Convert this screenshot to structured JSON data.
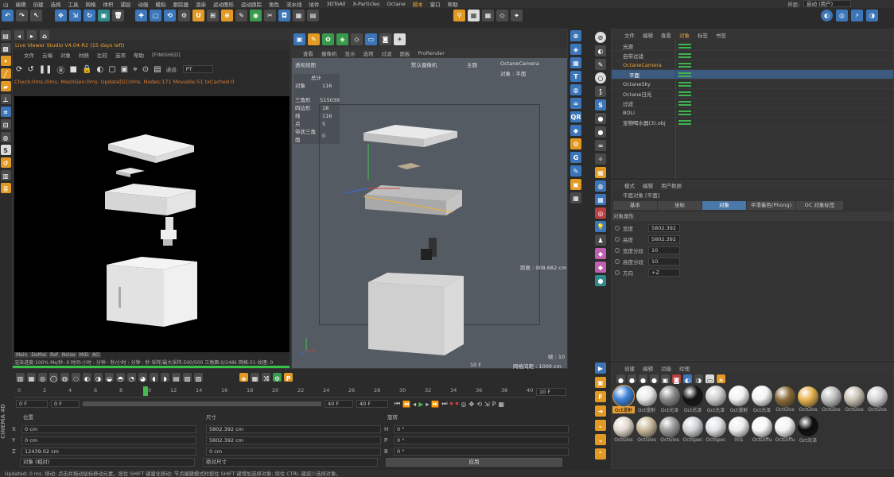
{
  "menubar": {
    "items": [
      "山",
      "编辑",
      "创建",
      "选择",
      "工具",
      "网格",
      "体积",
      "捕捉",
      "动画",
      "模拟",
      "跟踪器",
      "渲染",
      "运动图形",
      "运动跟踪",
      "角色",
      "流水线",
      "插件",
      "3DToAll",
      "X-Particles",
      "Octane",
      "脚本",
      "窗口",
      "帮助"
    ],
    "layout_label": "界面:",
    "layout_value": "启动 (用户)"
  },
  "live_viewer": {
    "title": "Live Viewer Studio V4.04-R2 (15 days left)",
    "menu": [
      "文件",
      "云端",
      "对象",
      "材质",
      "比较",
      "选项",
      "帮助"
    ],
    "status": "[FINISHED]",
    "channel_label": "通道:",
    "channel_value": "PT",
    "check_line": "Check:0ms./0ms. MeshGen:0ms. Update[G]:0ms. Nodes:171 Movable:51 txCached:0",
    "bottom_tabs": [
      "Main",
      "DeMai",
      "Ref",
      "Noise",
      "MID",
      "AO"
    ],
    "stats_line": "渲染进度:100%    Ms/秒: 0    时间:小时 : 分钟 : 秒/小时 : 分钟 : 秒    采样/最大采样:500/500    三角面:0/248k    网格:51   纹理: 0"
  },
  "viewport": {
    "menu": [
      "查看",
      "摄像机",
      "显示",
      "选项",
      "过滤",
      "面板",
      "ProRender"
    ],
    "view_name": "透视视图",
    "camera_label": "默认摄像机",
    "camera_value": "OctaneCamera",
    "main_label": "主题",
    "object_label": "对象 : 平面",
    "stats_header": "总计",
    "stats": [
      {
        "k": "对象",
        "v": "116"
      },
      {
        "k": "三角形",
        "v": "515039"
      },
      {
        "k": "四边形",
        "v": "18"
      },
      {
        "k": "线",
        "v": "116"
      },
      {
        "k": "点",
        "v": "5"
      },
      {
        "k": "带状三角面",
        "v": "0"
      }
    ],
    "distance": "距离 : 908.682 cm",
    "frame": "帧 : 10",
    "frame_indicator": "10 F",
    "grid_spacing": "网格间距 : 1000 cm"
  },
  "timeline": {
    "ticks": [
      "0",
      "2",
      "4",
      "6",
      "8",
      "10",
      "12",
      "14",
      "16",
      "18",
      "20",
      "22",
      "24",
      "26",
      "28",
      "30",
      "32",
      "34",
      "36",
      "38",
      "40"
    ],
    "current_frame": "10 F",
    "current": 10,
    "start_field": "0 F",
    "start_field2": "0 F",
    "end_field": "40 F",
    "end_field2": "40 F"
  },
  "coords": {
    "headers": [
      "位置",
      "尺寸",
      "旋转"
    ],
    "rows": [
      {
        "axis": "X",
        "pos": "0 cm",
        "size": "5802.392 cm",
        "rot_axis": "H",
        "rot": "0 °"
      },
      {
        "axis": "Y",
        "pos": "0 cm",
        "size": "5802.392 cm",
        "rot_axis": "P",
        "rot": "0 °"
      },
      {
        "axis": "Z",
        "pos": "12439.02 cm",
        "size": "0 cm",
        "rot_axis": "B",
        "rot": "0 °"
      }
    ],
    "mode_left": "对象 (相对)",
    "mode_mid": "绝对尺寸",
    "apply": "应用"
  },
  "statusbar": "Updated: 0 ms.    移动: 点击并拖动鼠标移动元素。按住 SHIFT 键量化移动; 节点编辑模式时按住 SHIFT 键增加选择对象; 按住 CTRL 键减少选择对象。",
  "brand": "CINEMA 4D",
  "objects": {
    "menu": [
      "文件",
      "编辑",
      "查看",
      "对象",
      "标签",
      "书签"
    ],
    "items": [
      {
        "name": "光源",
        "indent": 0,
        "sel": false,
        "hl": false
      },
      {
        "name": "自带过滤",
        "indent": 0,
        "sel": false,
        "hl": false
      },
      {
        "name": "OctaneCamera",
        "indent": 0,
        "sel": false,
        "hl": true
      },
      {
        "name": "平面",
        "indent": 1,
        "sel": true,
        "hl": false
      },
      {
        "name": "OctaneSky",
        "indent": 0,
        "sel": false,
        "hl": false
      },
      {
        "name": "Octane日光",
        "indent": 0,
        "sel": false,
        "hl": false
      },
      {
        "name": "过滤",
        "indent": 0,
        "sel": false,
        "hl": false
      },
      {
        "name": "BOLI",
        "indent": 0,
        "sel": false,
        "hl": false
      },
      {
        "name": "宠物喝水器(3).obj",
        "indent": 0,
        "sel": false,
        "hl": false
      }
    ]
  },
  "attributes": {
    "menu": [
      "模式",
      "编辑",
      "用户数据"
    ],
    "title": "平面对象 [平面]",
    "tabs": [
      "基本",
      "坐标",
      "对象",
      "平滑着色(Phong)",
      "OC 对象标签"
    ],
    "active_tab": "对象",
    "section": "对象属性",
    "fields": [
      {
        "label": "宽度",
        "value": "5802.392"
      },
      {
        "label": "高度",
        "value": "5802.392"
      },
      {
        "label": "宽度分段",
        "value": "10"
      },
      {
        "label": "高度分段",
        "value": "10"
      },
      {
        "label": "方向",
        "value": "+Z"
      }
    ]
  },
  "materials": {
    "menu": [
      "创建",
      "编辑",
      "功能",
      "纹理"
    ],
    "row1": [
      {
        "name": "Oct漫射",
        "color": "#3c82d8",
        "sel": true
      },
      {
        "name": "Oct漫射",
        "color": "#e8e8e8",
        "sel": false
      },
      {
        "name": "Oct光泽",
        "color": "#8a8a8a",
        "sel": false
      },
      {
        "name": "Oct光泽",
        "color": "#141414",
        "sel": false
      },
      {
        "name": "Oct光泽",
        "color": "#cfcfcf",
        "sel": false
      },
      {
        "name": "Oct漫射",
        "color": "#f2f2f2",
        "sel": false
      },
      {
        "name": "Oct光泽",
        "color": "#f4f4f4",
        "sel": false
      },
      {
        "name": "OctGlos",
        "color": "#8a6a38",
        "sel": false
      },
      {
        "name": "OctGlos",
        "color": "#e3b04b",
        "sel": false
      },
      {
        "name": "OctGlos",
        "color": "#bdbdbd",
        "sel": false
      },
      {
        "name": "OctGlos",
        "color": "#c7c0b2",
        "sel": false
      },
      {
        "name": "OctGlos",
        "color": "#d0d0d0",
        "sel": false
      }
    ],
    "row2": [
      {
        "name": "OctGlos",
        "color": "#e0d8cc",
        "sel": false
      },
      {
        "name": "OctGlos",
        "color": "#c9b89a",
        "sel": false
      },
      {
        "name": "OctGlos",
        "color": "#9a9a9a",
        "sel": false
      },
      {
        "name": "OctSpec",
        "color": "#cfd3d6",
        "sel": false
      },
      {
        "name": "OctSpec",
        "color": "#dfe3e6",
        "sel": false
      },
      {
        "name": "001",
        "color": "#ededed",
        "sel": false
      },
      {
        "name": "OctDiffu",
        "color": "#f6f6f6",
        "sel": false
      },
      {
        "name": "OctDiffu",
        "color": "#f3f3f3",
        "sel": false
      },
      {
        "name": "Oct光泽",
        "color": "#0c0c0c",
        "sel": false
      }
    ]
  }
}
